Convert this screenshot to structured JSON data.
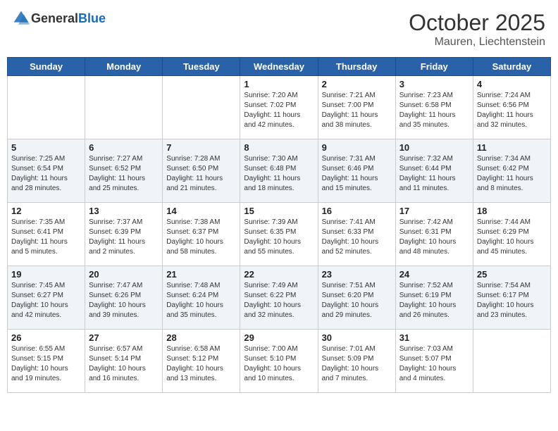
{
  "header": {
    "logo_general": "General",
    "logo_blue": "Blue",
    "month": "October 2025",
    "location": "Mauren, Liechtenstein"
  },
  "days_of_week": [
    "Sunday",
    "Monday",
    "Tuesday",
    "Wednesday",
    "Thursday",
    "Friday",
    "Saturday"
  ],
  "weeks": [
    [
      {
        "day": "",
        "text": ""
      },
      {
        "day": "",
        "text": ""
      },
      {
        "day": "",
        "text": ""
      },
      {
        "day": "1",
        "text": "Sunrise: 7:20 AM\nSunset: 7:02 PM\nDaylight: 11 hours\nand 42 minutes."
      },
      {
        "day": "2",
        "text": "Sunrise: 7:21 AM\nSunset: 7:00 PM\nDaylight: 11 hours\nand 38 minutes."
      },
      {
        "day": "3",
        "text": "Sunrise: 7:23 AM\nSunset: 6:58 PM\nDaylight: 11 hours\nand 35 minutes."
      },
      {
        "day": "4",
        "text": "Sunrise: 7:24 AM\nSunset: 6:56 PM\nDaylight: 11 hours\nand 32 minutes."
      }
    ],
    [
      {
        "day": "5",
        "text": "Sunrise: 7:25 AM\nSunset: 6:54 PM\nDaylight: 11 hours\nand 28 minutes."
      },
      {
        "day": "6",
        "text": "Sunrise: 7:27 AM\nSunset: 6:52 PM\nDaylight: 11 hours\nand 25 minutes."
      },
      {
        "day": "7",
        "text": "Sunrise: 7:28 AM\nSunset: 6:50 PM\nDaylight: 11 hours\nand 21 minutes."
      },
      {
        "day": "8",
        "text": "Sunrise: 7:30 AM\nSunset: 6:48 PM\nDaylight: 11 hours\nand 18 minutes."
      },
      {
        "day": "9",
        "text": "Sunrise: 7:31 AM\nSunset: 6:46 PM\nDaylight: 11 hours\nand 15 minutes."
      },
      {
        "day": "10",
        "text": "Sunrise: 7:32 AM\nSunset: 6:44 PM\nDaylight: 11 hours\nand 11 minutes."
      },
      {
        "day": "11",
        "text": "Sunrise: 7:34 AM\nSunset: 6:42 PM\nDaylight: 11 hours\nand 8 minutes."
      }
    ],
    [
      {
        "day": "12",
        "text": "Sunrise: 7:35 AM\nSunset: 6:41 PM\nDaylight: 11 hours\nand 5 minutes."
      },
      {
        "day": "13",
        "text": "Sunrise: 7:37 AM\nSunset: 6:39 PM\nDaylight: 11 hours\nand 2 minutes."
      },
      {
        "day": "14",
        "text": "Sunrise: 7:38 AM\nSunset: 6:37 PM\nDaylight: 10 hours\nand 58 minutes."
      },
      {
        "day": "15",
        "text": "Sunrise: 7:39 AM\nSunset: 6:35 PM\nDaylight: 10 hours\nand 55 minutes."
      },
      {
        "day": "16",
        "text": "Sunrise: 7:41 AM\nSunset: 6:33 PM\nDaylight: 10 hours\nand 52 minutes."
      },
      {
        "day": "17",
        "text": "Sunrise: 7:42 AM\nSunset: 6:31 PM\nDaylight: 10 hours\nand 48 minutes."
      },
      {
        "day": "18",
        "text": "Sunrise: 7:44 AM\nSunset: 6:29 PM\nDaylight: 10 hours\nand 45 minutes."
      }
    ],
    [
      {
        "day": "19",
        "text": "Sunrise: 7:45 AM\nSunset: 6:27 PM\nDaylight: 10 hours\nand 42 minutes."
      },
      {
        "day": "20",
        "text": "Sunrise: 7:47 AM\nSunset: 6:26 PM\nDaylight: 10 hours\nand 39 minutes."
      },
      {
        "day": "21",
        "text": "Sunrise: 7:48 AM\nSunset: 6:24 PM\nDaylight: 10 hours\nand 35 minutes."
      },
      {
        "day": "22",
        "text": "Sunrise: 7:49 AM\nSunset: 6:22 PM\nDaylight: 10 hours\nand 32 minutes."
      },
      {
        "day": "23",
        "text": "Sunrise: 7:51 AM\nSunset: 6:20 PM\nDaylight: 10 hours\nand 29 minutes."
      },
      {
        "day": "24",
        "text": "Sunrise: 7:52 AM\nSunset: 6:19 PM\nDaylight: 10 hours\nand 26 minutes."
      },
      {
        "day": "25",
        "text": "Sunrise: 7:54 AM\nSunset: 6:17 PM\nDaylight: 10 hours\nand 23 minutes."
      }
    ],
    [
      {
        "day": "26",
        "text": "Sunrise: 6:55 AM\nSunset: 5:15 PM\nDaylight: 10 hours\nand 19 minutes."
      },
      {
        "day": "27",
        "text": "Sunrise: 6:57 AM\nSunset: 5:14 PM\nDaylight: 10 hours\nand 16 minutes."
      },
      {
        "day": "28",
        "text": "Sunrise: 6:58 AM\nSunset: 5:12 PM\nDaylight: 10 hours\nand 13 minutes."
      },
      {
        "day": "29",
        "text": "Sunrise: 7:00 AM\nSunset: 5:10 PM\nDaylight: 10 hours\nand 10 minutes."
      },
      {
        "day": "30",
        "text": "Sunrise: 7:01 AM\nSunset: 5:09 PM\nDaylight: 10 hours\nand 7 minutes."
      },
      {
        "day": "31",
        "text": "Sunrise: 7:03 AM\nSunset: 5:07 PM\nDaylight: 10 hours\nand 4 minutes."
      },
      {
        "day": "",
        "text": ""
      }
    ]
  ]
}
